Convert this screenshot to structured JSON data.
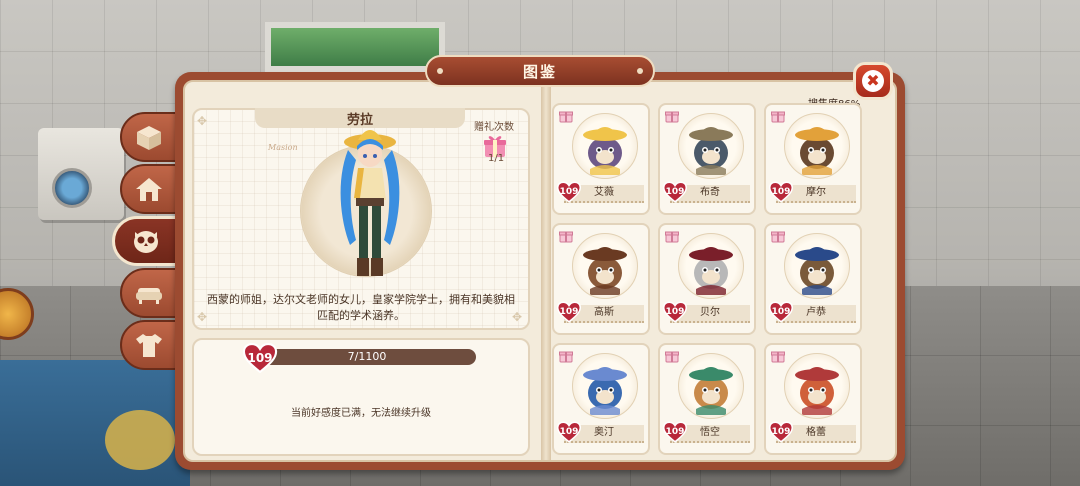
{
  "window": {
    "title": "图鉴",
    "close_glyph": "✖"
  },
  "side_tabs": [
    {
      "icon": "box-icon"
    },
    {
      "icon": "home-icon"
    },
    {
      "icon": "owl-icon",
      "active": true
    },
    {
      "icon": "sofa-icon"
    },
    {
      "icon": "shirt-icon"
    }
  ],
  "profile": {
    "name": "劳拉",
    "script_text": "Masion",
    "gift_label": "赠礼次数",
    "gift_count": "1/1",
    "description": "西蒙的师姐，达尔文老师的女儿，皇家学院学士，拥有和美貌相匹配的学术涵养。"
  },
  "level": {
    "value": "109",
    "progress_text": "7/1100",
    "progress_fraction": 0.0064,
    "status_text": "当前好感度已满，无法继续升级"
  },
  "collection": {
    "label": "搜集度86%"
  },
  "characters": [
    {
      "name": "艾薇",
      "level": "109",
      "color": "#6e5a8a",
      "hat": "#f0c44a"
    },
    {
      "name": "布奇",
      "level": "109",
      "color": "#4b5a6a",
      "hat": "#8a7a5a"
    },
    {
      "name": "摩尔",
      "level": "109",
      "color": "#6a4a32",
      "hat": "#e2a13a"
    },
    {
      "name": "高斯",
      "level": "109",
      "color": "#8a5a3a",
      "hat": "#6a3a22"
    },
    {
      "name": "贝尔",
      "level": "109",
      "color": "#b8b8b8",
      "hat": "#7a1f2a"
    },
    {
      "name": "卢恭",
      "level": "109",
      "color": "#7a5a3a",
      "hat": "#2a4a8a"
    },
    {
      "name": "奥汀",
      "level": "109",
      "color": "#3a6ab0",
      "hat": "#6a8ad0"
    },
    {
      "name": "悟空",
      "level": "109",
      "color": "#c98a4a",
      "hat": "#3a8a6a"
    },
    {
      "name": "格蕾",
      "level": "109",
      "color": "#d0603a",
      "hat": "#b03a3a"
    }
  ],
  "colors": {
    "accent": "#9c4b31",
    "page": "#f3ebdb",
    "heart": "#b8283a"
  }
}
